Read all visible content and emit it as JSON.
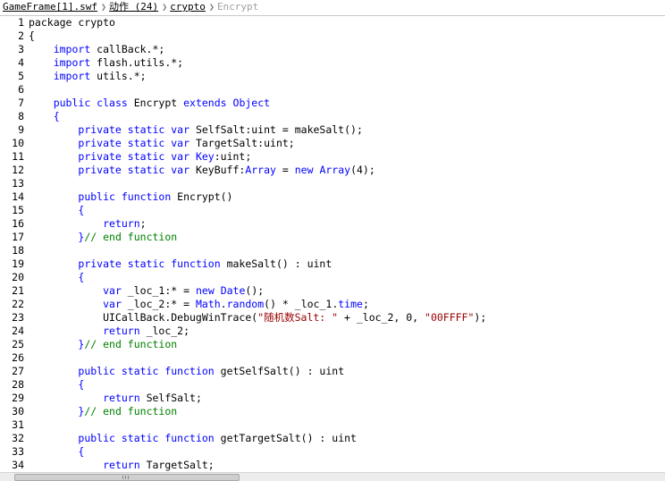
{
  "breadcrumb": {
    "items": [
      {
        "label": "GameFrame[1].swf",
        "current": false
      },
      {
        "label": "动作 (24)",
        "current": false
      },
      {
        "label": "crypto",
        "current": false
      },
      {
        "label": "Encrypt",
        "current": true
      }
    ]
  },
  "colors": {
    "keyword": "#0000ff",
    "comment": "#008000",
    "string": "#990000",
    "text": "#000000"
  },
  "editor": {
    "lines": [
      {
        "n": "1",
        "tokens": [
          [
            "t",
            "package crypto"
          ]
        ]
      },
      {
        "n": "2",
        "tokens": [
          [
            "t",
            "{"
          ]
        ]
      },
      {
        "n": "3",
        "tokens": [
          [
            "t",
            "    "
          ],
          [
            "k",
            "import"
          ],
          [
            "t",
            " callBack.*;"
          ]
        ]
      },
      {
        "n": "4",
        "tokens": [
          [
            "t",
            "    "
          ],
          [
            "k",
            "import"
          ],
          [
            "t",
            " flash.utils.*;"
          ]
        ]
      },
      {
        "n": "5",
        "tokens": [
          [
            "t",
            "    "
          ],
          [
            "k",
            "import"
          ],
          [
            "t",
            " utils.*;"
          ]
        ]
      },
      {
        "n": "6",
        "tokens": []
      },
      {
        "n": "7",
        "tokens": [
          [
            "t",
            "    "
          ],
          [
            "k",
            "public class"
          ],
          [
            "t",
            " Encrypt "
          ],
          [
            "k",
            "extends"
          ],
          [
            "t",
            " "
          ],
          [
            "k",
            "Object"
          ]
        ]
      },
      {
        "n": "8",
        "tokens": [
          [
            "t",
            "    "
          ],
          [
            "k",
            "{"
          ]
        ]
      },
      {
        "n": "9",
        "tokens": [
          [
            "t",
            "        "
          ],
          [
            "k",
            "private static var"
          ],
          [
            "t",
            " SelfSalt:uint = makeSalt();"
          ]
        ]
      },
      {
        "n": "10",
        "tokens": [
          [
            "t",
            "        "
          ],
          [
            "k",
            "private static var"
          ],
          [
            "t",
            " TargetSalt:uint;"
          ]
        ]
      },
      {
        "n": "11",
        "tokens": [
          [
            "t",
            "        "
          ],
          [
            "k",
            "private static var"
          ],
          [
            "t",
            " "
          ],
          [
            "k",
            "Key"
          ],
          [
            "t",
            ":uint;"
          ]
        ]
      },
      {
        "n": "12",
        "tokens": [
          [
            "t",
            "        "
          ],
          [
            "k",
            "private static var"
          ],
          [
            "t",
            " KeyBuff:"
          ],
          [
            "k",
            "Array"
          ],
          [
            "t",
            " = "
          ],
          [
            "k",
            "new"
          ],
          [
            "t",
            " "
          ],
          [
            "k",
            "Array"
          ],
          [
            "t",
            "(4);"
          ]
        ]
      },
      {
        "n": "13",
        "tokens": []
      },
      {
        "n": "14",
        "tokens": [
          [
            "t",
            "        "
          ],
          [
            "k",
            "public function"
          ],
          [
            "t",
            " Encrypt()"
          ]
        ]
      },
      {
        "n": "15",
        "tokens": [
          [
            "t",
            "        "
          ],
          [
            "k",
            "{"
          ]
        ]
      },
      {
        "n": "16",
        "tokens": [
          [
            "t",
            "            "
          ],
          [
            "k",
            "return"
          ],
          [
            "t",
            ";"
          ]
        ]
      },
      {
        "n": "17",
        "tokens": [
          [
            "t",
            "        "
          ],
          [
            "k",
            "}"
          ],
          [
            "c",
            "// end function"
          ]
        ]
      },
      {
        "n": "18",
        "tokens": []
      },
      {
        "n": "19",
        "tokens": [
          [
            "t",
            "        "
          ],
          [
            "k",
            "private static function"
          ],
          [
            "t",
            " makeSalt() : uint"
          ]
        ]
      },
      {
        "n": "20",
        "tokens": [
          [
            "t",
            "        "
          ],
          [
            "k",
            "{"
          ]
        ]
      },
      {
        "n": "21",
        "tokens": [
          [
            "t",
            "            "
          ],
          [
            "k",
            "var"
          ],
          [
            "t",
            " _loc_1:* = "
          ],
          [
            "k",
            "new"
          ],
          [
            "t",
            " "
          ],
          [
            "k",
            "Date"
          ],
          [
            "t",
            "();"
          ]
        ]
      },
      {
        "n": "22",
        "tokens": [
          [
            "t",
            "            "
          ],
          [
            "k",
            "var"
          ],
          [
            "t",
            " _loc_2:* = "
          ],
          [
            "k",
            "Math"
          ],
          [
            "t",
            "."
          ],
          [
            "k",
            "random"
          ],
          [
            "t",
            "() * _loc_1."
          ],
          [
            "k",
            "time"
          ],
          [
            "t",
            ";"
          ]
        ]
      },
      {
        "n": "23",
        "tokens": [
          [
            "t",
            "            UICallBack.DebugWinTrace("
          ],
          [
            "s",
            "\"随机数Salt: \""
          ],
          [
            "t",
            " + _loc_2, 0, "
          ],
          [
            "s",
            "\"00FFFF\""
          ],
          [
            "t",
            ");"
          ]
        ]
      },
      {
        "n": "24",
        "tokens": [
          [
            "t",
            "            "
          ],
          [
            "k",
            "return"
          ],
          [
            "t",
            " _loc_2;"
          ]
        ]
      },
      {
        "n": "25",
        "tokens": [
          [
            "t",
            "        "
          ],
          [
            "k",
            "}"
          ],
          [
            "c",
            "// end function"
          ]
        ]
      },
      {
        "n": "26",
        "tokens": []
      },
      {
        "n": "27",
        "tokens": [
          [
            "t",
            "        "
          ],
          [
            "k",
            "public static function"
          ],
          [
            "t",
            " getSelfSalt() : uint"
          ]
        ]
      },
      {
        "n": "28",
        "tokens": [
          [
            "t",
            "        "
          ],
          [
            "k",
            "{"
          ]
        ]
      },
      {
        "n": "29",
        "tokens": [
          [
            "t",
            "            "
          ],
          [
            "k",
            "return"
          ],
          [
            "t",
            " SelfSalt;"
          ]
        ]
      },
      {
        "n": "30",
        "tokens": [
          [
            "t",
            "        "
          ],
          [
            "k",
            "}"
          ],
          [
            "c",
            "// end function"
          ]
        ]
      },
      {
        "n": "31",
        "tokens": []
      },
      {
        "n": "32",
        "tokens": [
          [
            "t",
            "        "
          ],
          [
            "k",
            "public static function"
          ],
          [
            "t",
            " getTargetSalt() : uint"
          ]
        ]
      },
      {
        "n": "33",
        "tokens": [
          [
            "t",
            "        "
          ],
          [
            "k",
            "{"
          ]
        ]
      },
      {
        "n": "34",
        "tokens": [
          [
            "t",
            "            "
          ],
          [
            "k",
            "return"
          ],
          [
            "t",
            " TargetSalt;"
          ]
        ]
      }
    ]
  }
}
